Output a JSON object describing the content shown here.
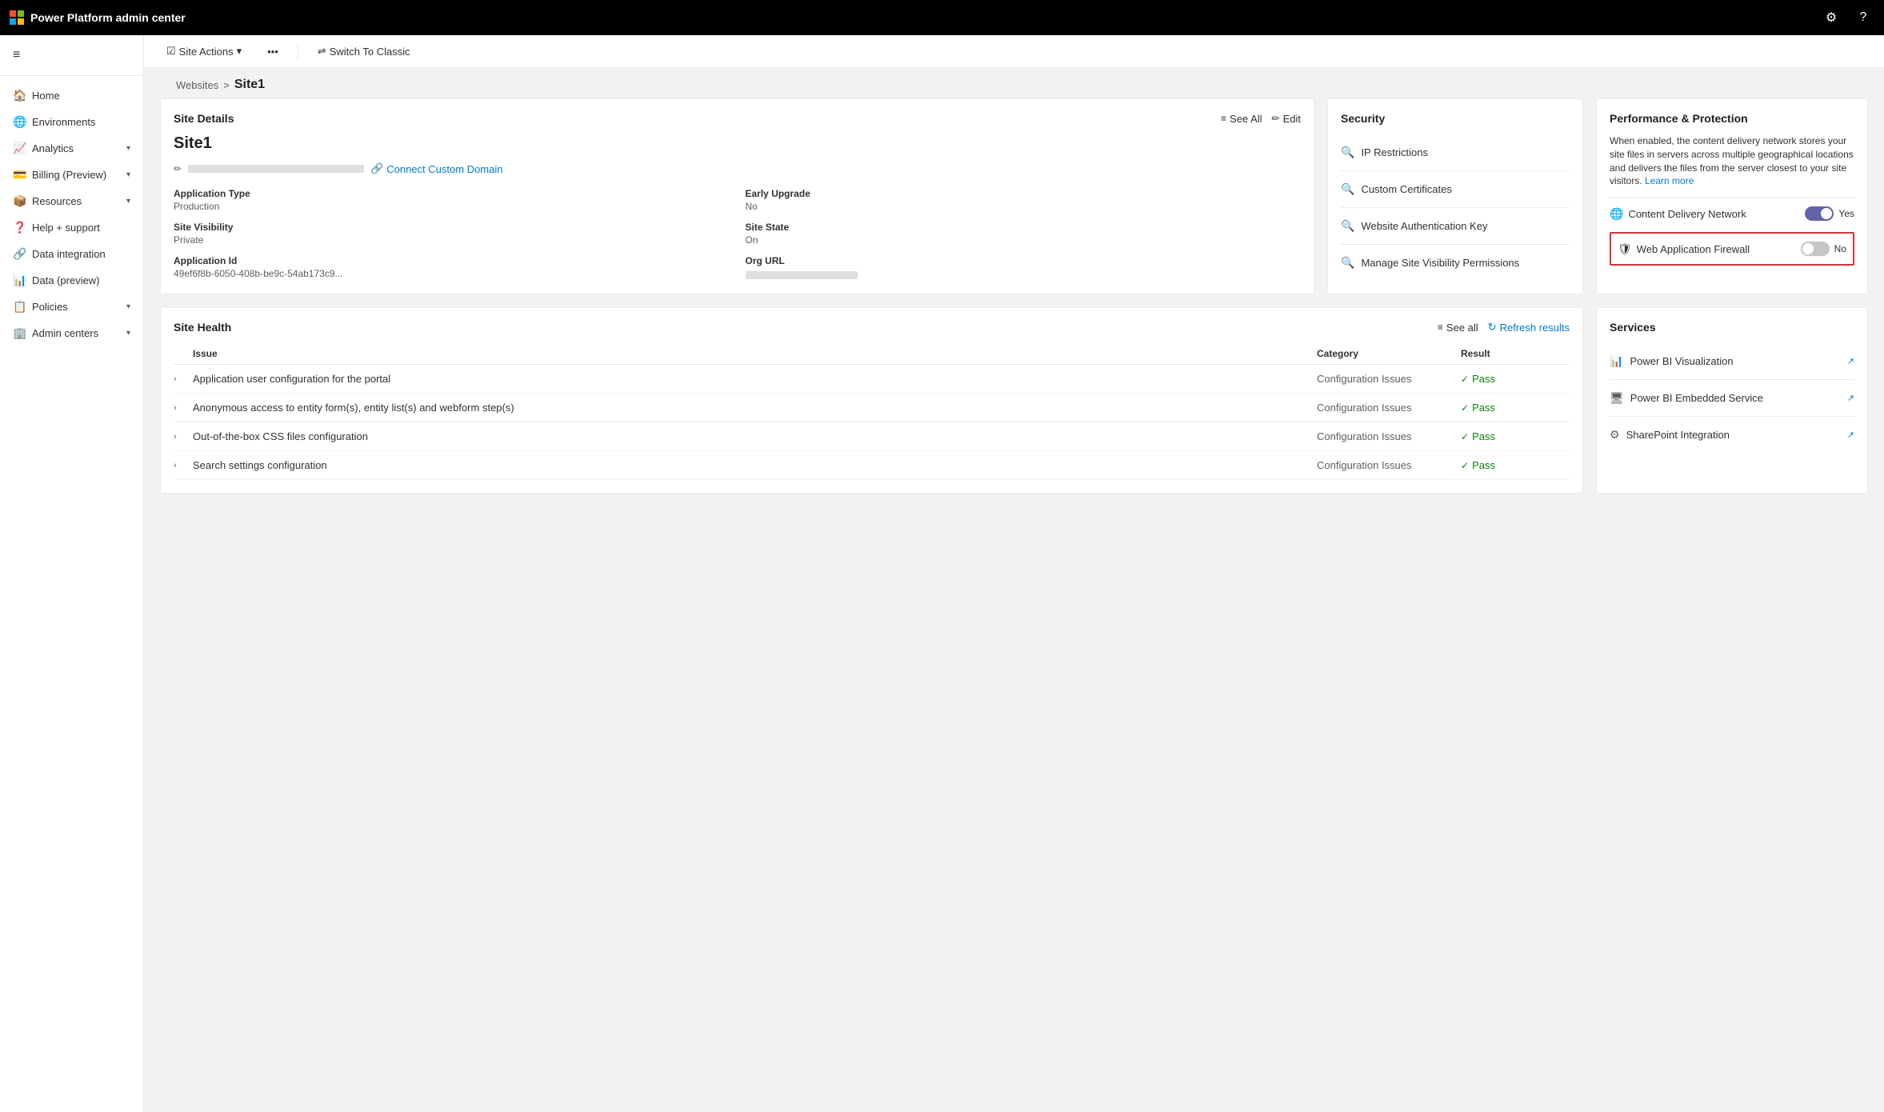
{
  "topbar": {
    "title": "Power Platform admin center",
    "settings_icon": "⚙",
    "help_icon": "?"
  },
  "sidebar": {
    "hamburger_icon": "≡",
    "items": [
      {
        "id": "home",
        "label": "Home",
        "icon": "🏠",
        "expandable": false
      },
      {
        "id": "environments",
        "label": "Environments",
        "icon": "🌐",
        "expandable": false
      },
      {
        "id": "analytics",
        "label": "Analytics",
        "icon": "📈",
        "expandable": true
      },
      {
        "id": "billing",
        "label": "Billing (Preview)",
        "icon": "💳",
        "expandable": true
      },
      {
        "id": "resources",
        "label": "Resources",
        "icon": "📦",
        "expandable": true
      },
      {
        "id": "help",
        "label": "Help + support",
        "icon": "❓",
        "expandable": false
      },
      {
        "id": "data-integration",
        "label": "Data integration",
        "icon": "🔗",
        "expandable": false
      },
      {
        "id": "data-preview",
        "label": "Data (preview)",
        "icon": "📊",
        "expandable": false
      },
      {
        "id": "policies",
        "label": "Policies",
        "icon": "📋",
        "expandable": true
      },
      {
        "id": "admin-centers",
        "label": "Admin centers",
        "icon": "🏢",
        "expandable": true
      }
    ]
  },
  "action_bar": {
    "site_actions_label": "Site Actions",
    "site_actions_icon": "▾",
    "more_icon": "•••",
    "switch_label": "Switch To Classic"
  },
  "breadcrumb": {
    "parent": "Websites",
    "separator": ">",
    "current": "Site1"
  },
  "site_details": {
    "card_title": "Site Details",
    "see_all_label": "See All",
    "edit_label": "Edit",
    "site_name": "Site1",
    "connect_domain_label": "Connect Custom Domain",
    "fields": [
      {
        "label": "Application Type",
        "value": "Production"
      },
      {
        "label": "Early Upgrade",
        "value": "No"
      },
      {
        "label": "Site Visibility",
        "value": "Private"
      },
      {
        "label": "Site State",
        "value": "On"
      },
      {
        "label": "Application Id",
        "value": "49ef6f8b-6050-408b-be9c-54ab173c9..."
      },
      {
        "label": "Org URL",
        "value": ""
      }
    ]
  },
  "security": {
    "card_title": "Security",
    "items": [
      {
        "id": "ip-restrictions",
        "label": "IP Restrictions",
        "icon": "🔍"
      },
      {
        "id": "custom-certificates",
        "label": "Custom Certificates",
        "icon": "🔍"
      },
      {
        "id": "website-auth-key",
        "label": "Website Authentication Key",
        "icon": "🔍"
      },
      {
        "id": "manage-visibility",
        "label": "Manage Site Visibility Permissions",
        "icon": "🔍"
      }
    ]
  },
  "performance": {
    "card_title": "Performance & Protection",
    "description": "When enabled, the content delivery network stores your site files in servers across multiple geographical locations and delivers the files from the server closest to your site visitors.",
    "learn_more_label": "Learn more",
    "cdn_label": "Content Delivery Network",
    "cdn_state": "on",
    "cdn_value_text": "Yes",
    "waf_label": "Web Application Firewall",
    "waf_state": "off",
    "waf_value_text": "No",
    "cdn_icon": "🌐",
    "waf_icon": "🛡"
  },
  "site_health": {
    "card_title": "Site Health",
    "see_all_label": "See all",
    "refresh_label": "Refresh results",
    "table_headers": [
      "",
      "Issue",
      "Category",
      "Result",
      ""
    ],
    "rows": [
      {
        "issue": "Application user configuration for the portal",
        "category": "Configuration Issues",
        "result": "Pass"
      },
      {
        "issue": "Anonymous access to entity form(s), entity list(s) and webform step(s)",
        "category": "Configuration Issues",
        "result": "Pass"
      },
      {
        "issue": "Out-of-the-box CSS files configuration",
        "category": "Configuration Issues",
        "result": "Pass"
      },
      {
        "issue": "Search settings configuration",
        "category": "Configuration Issues",
        "result": "Pass"
      }
    ]
  },
  "services": {
    "card_title": "Services",
    "items": [
      {
        "id": "power-bi-viz",
        "label": "Power BI Visualization",
        "icon": "📊"
      },
      {
        "id": "power-bi-embedded",
        "label": "Power BI Embedded Service",
        "icon": "🖥"
      },
      {
        "id": "sharepoint",
        "label": "SharePoint Integration",
        "icon": "⚙"
      }
    ]
  }
}
